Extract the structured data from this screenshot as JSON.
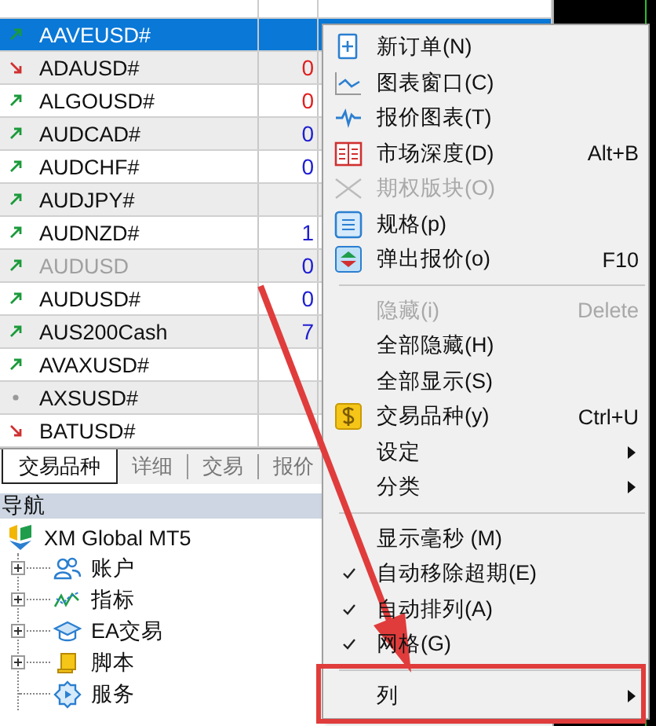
{
  "market_watch": {
    "rows": [
      {
        "symbol": "AAVEUSD#",
        "kind": "up",
        "selected": true,
        "disabled": false
      },
      {
        "symbol": "ADAUSD#",
        "kind": "down",
        "selected": false,
        "disabled": false,
        "bid": "0",
        "color": "#e02020"
      },
      {
        "symbol": "ALGOUSD#",
        "kind": "up",
        "selected": false,
        "disabled": false,
        "bid": "0",
        "color": "#e02020"
      },
      {
        "symbol": "AUDCAD#",
        "kind": "up",
        "selected": false,
        "disabled": false,
        "bid": "0",
        "color": "#2020d0"
      },
      {
        "symbol": "AUDCHF#",
        "kind": "up",
        "selected": false,
        "disabled": false,
        "bid": "0",
        "color": "#2020d0"
      },
      {
        "symbol": "AUDJPY#",
        "kind": "up",
        "selected": false,
        "disabled": false
      },
      {
        "symbol": "AUDNZD#",
        "kind": "up",
        "selected": false,
        "disabled": false,
        "bid": "1",
        "color": "#2020d0"
      },
      {
        "symbol": "AUDUSD",
        "kind": "up",
        "selected": false,
        "disabled": true,
        "bid": "0",
        "color": "#2020d0"
      },
      {
        "symbol": "AUDUSD#",
        "kind": "up",
        "selected": false,
        "disabled": false,
        "bid": "0",
        "color": "#2020d0"
      },
      {
        "symbol": "AUS200Cash",
        "kind": "up",
        "selected": false,
        "disabled": false,
        "bid": "7",
        "color": "#2020d0"
      },
      {
        "symbol": "AVAXUSD#",
        "kind": "up",
        "selected": false,
        "disabled": false
      },
      {
        "symbol": "AXSUSD#",
        "kind": "none",
        "selected": false,
        "disabled": false
      },
      {
        "symbol": "BATUSD#",
        "kind": "down",
        "selected": false,
        "disabled": false
      }
    ],
    "tabs": [
      {
        "label": "交易品种",
        "selected": true
      },
      {
        "label": "详细",
        "selected": false
      },
      {
        "label": "交易",
        "selected": false
      },
      {
        "label": "报价",
        "selected": false
      }
    ]
  },
  "navigator": {
    "title": "导航",
    "tree": [
      {
        "label": "XM Global MT5",
        "kind": "root",
        "children": [
          {
            "label": "账户",
            "kind": "folder",
            "expanded": false
          },
          {
            "label": "指标",
            "kind": "folder",
            "expanded": false
          },
          {
            "label": "EA交易",
            "kind": "folder",
            "expanded": false
          },
          {
            "label": "脚本",
            "kind": "folder",
            "expanded": false
          },
          {
            "label": "服务",
            "kind": "leaf"
          }
        ]
      }
    ]
  },
  "context_menu": {
    "items": [
      {
        "kind": "item",
        "label": "新订单(N)",
        "disabled": false,
        "checked": false,
        "submenu": false
      },
      {
        "kind": "item",
        "label": "图表窗口(C)",
        "disabled": false,
        "checked": false,
        "submenu": false
      },
      {
        "kind": "item",
        "label": "报价图表(T)",
        "disabled": false,
        "checked": false,
        "submenu": false
      },
      {
        "kind": "item",
        "label": "市场深度(D)",
        "shortcut": "Alt+B",
        "disabled": false,
        "checked": false,
        "submenu": false
      },
      {
        "kind": "item",
        "label": "期权版块(O)",
        "disabled": true,
        "checked": false,
        "submenu": false
      },
      {
        "kind": "item",
        "label": "规格(p)",
        "disabled": false,
        "checked": false,
        "submenu": false
      },
      {
        "kind": "item",
        "label": "弹出报价(o)",
        "shortcut": "F10",
        "disabled": false,
        "checked": false,
        "submenu": false
      },
      {
        "kind": "separator"
      },
      {
        "kind": "item",
        "label": "隐藏(i)",
        "shortcut": "Delete",
        "disabled": true,
        "checked": false,
        "submenu": false
      },
      {
        "kind": "item",
        "label": "全部隐藏(H)",
        "disabled": false,
        "checked": false,
        "submenu": false
      },
      {
        "kind": "item",
        "label": "全部显示(S)",
        "disabled": false,
        "checked": false,
        "submenu": false
      },
      {
        "kind": "item",
        "label": "交易品种(y)",
        "shortcut": "Ctrl+U",
        "disabled": false,
        "checked": false,
        "submenu": false
      },
      {
        "kind": "item",
        "label": "设定",
        "disabled": false,
        "checked": false,
        "submenu": true
      },
      {
        "kind": "item",
        "label": "分类",
        "disabled": false,
        "checked": false,
        "submenu": true
      },
      {
        "kind": "separator"
      },
      {
        "kind": "item",
        "label": "显示毫秒 (M)",
        "disabled": false,
        "checked": false,
        "submenu": false
      },
      {
        "kind": "item",
        "label": "自动移除超期(E)",
        "disabled": false,
        "checked": true,
        "submenu": false
      },
      {
        "kind": "item",
        "label": "自动排列(A)",
        "disabled": false,
        "checked": true,
        "submenu": false
      },
      {
        "kind": "item",
        "label": "网格(G)",
        "disabled": false,
        "checked": true,
        "submenu": false
      },
      {
        "kind": "separator"
      },
      {
        "kind": "item",
        "label": "列",
        "disabled": false,
        "checked": false,
        "submenu": true
      }
    ]
  }
}
